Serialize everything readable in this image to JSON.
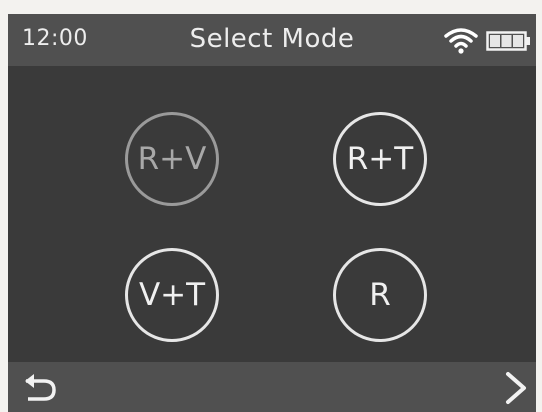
{
  "status_bar": {
    "time": "12:00",
    "title": "Select Mode",
    "wifi_icon": "wifi-icon",
    "battery_icon": "battery-icon"
  },
  "modes": [
    {
      "label": "R+V",
      "state": "dimmed"
    },
    {
      "label": "R+T",
      "state": "normal"
    },
    {
      "label": "V+T",
      "state": "normal"
    },
    {
      "label": "R",
      "state": "normal"
    }
  ],
  "bottom_bar": {
    "back_icon": "back-arrow-icon",
    "next_icon": "chevron-right-icon"
  },
  "colors": {
    "screen_bg": "#3a3a3a",
    "bar_bg": "#505050",
    "text": "#ededed",
    "dim": "#9a9a9a"
  }
}
